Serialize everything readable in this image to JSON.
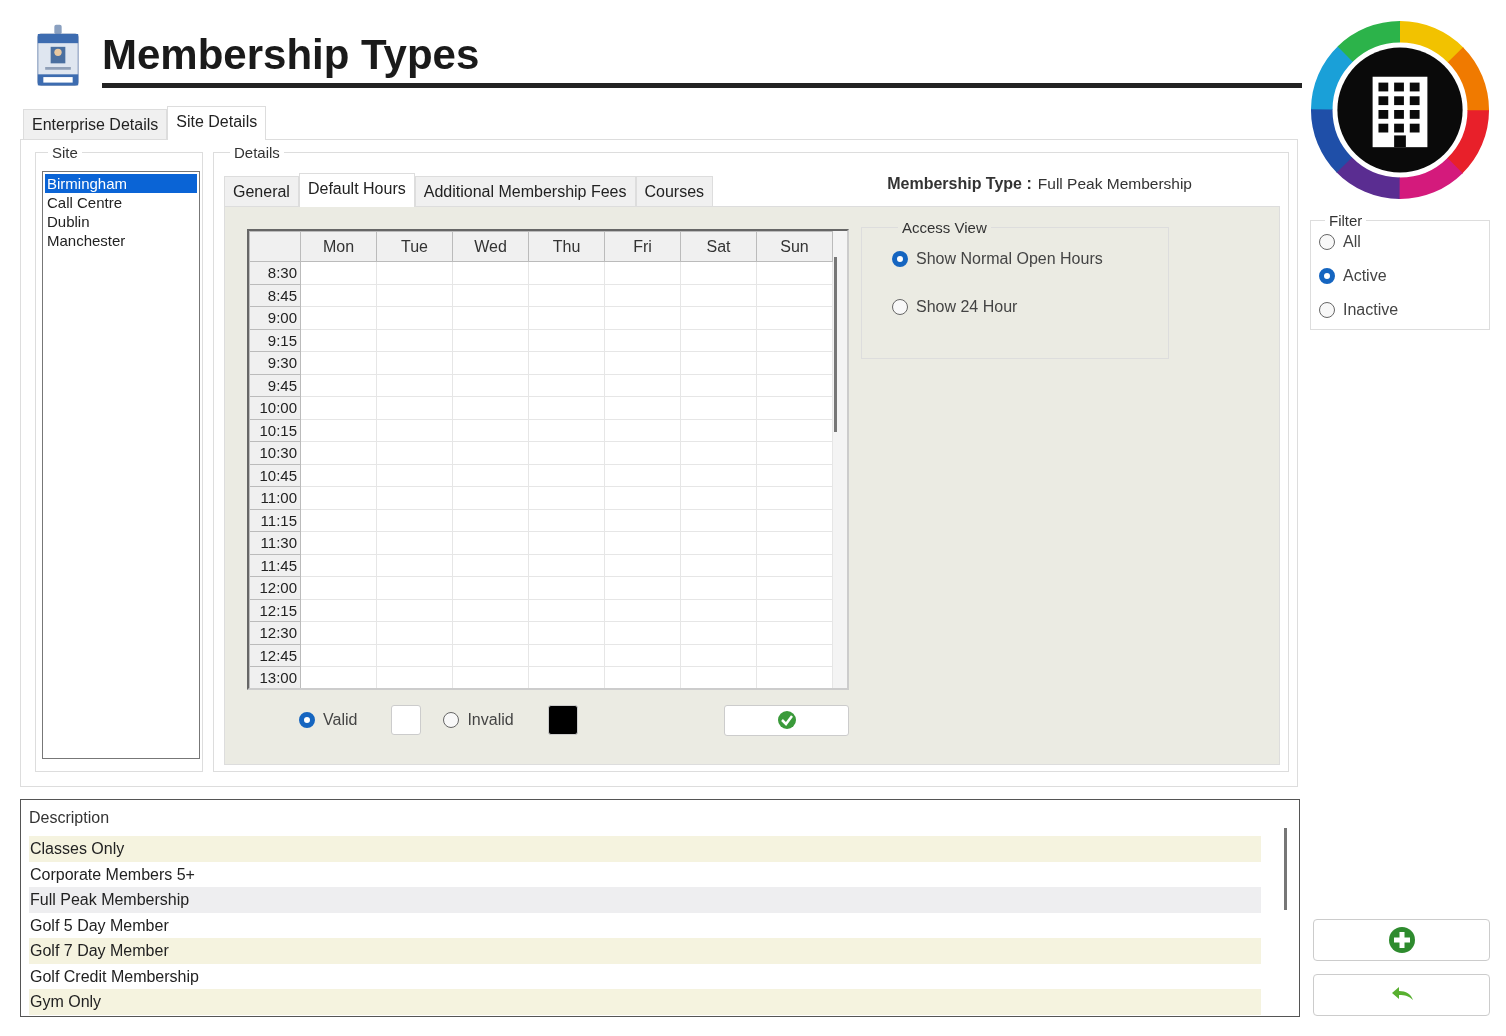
{
  "header": {
    "title": "Membership Types"
  },
  "tabs": [
    {
      "label": "Enterprise Details",
      "selected": false
    },
    {
      "label": "Site Details",
      "selected": true
    }
  ],
  "site": {
    "legend": "Site",
    "items": [
      {
        "label": "Birmingham",
        "selected": true
      },
      {
        "label": "Call Centre",
        "selected": false
      },
      {
        "label": "Dublin",
        "selected": false
      },
      {
        "label": "Manchester",
        "selected": false
      }
    ]
  },
  "details": {
    "legend": "Details",
    "tabs": [
      {
        "label": "General",
        "selected": false
      },
      {
        "label": "Default Hours",
        "selected": true
      },
      {
        "label": "Additional Membership Fees",
        "selected": false
      },
      {
        "label": "Courses",
        "selected": false
      }
    ],
    "membership_type": {
      "label": "Membership Type :",
      "value": "Full Peak Membership"
    },
    "schedule": {
      "columns": [
        "Mon",
        "Tue",
        "Wed",
        "Thu",
        "Fri",
        "Sat",
        "Sun"
      ],
      "times": [
        "8:30",
        "8:45",
        "9:00",
        "9:15",
        "9:30",
        "9:45",
        "10:00",
        "10:15",
        "10:30",
        "10:45",
        "11:00",
        "11:15",
        "11:30",
        "11:45",
        "12:00",
        "12:15",
        "12:30",
        "12:45",
        "13:00"
      ]
    },
    "legend_options": [
      {
        "label": "Valid",
        "selected": true,
        "color": "#ffffff"
      },
      {
        "label": "Invalid",
        "selected": false,
        "color": "#000000"
      }
    ],
    "access_view": {
      "legend": "Access View",
      "options": [
        {
          "label": "Show Normal Open Hours",
          "selected": true
        },
        {
          "label": "Show 24 Hour",
          "selected": false
        }
      ]
    }
  },
  "description_list": {
    "header": "Description",
    "rows": [
      {
        "label": "Classes Only",
        "selected": false
      },
      {
        "label": "Corporate Members 5+",
        "selected": false
      },
      {
        "label": "Full Peak Membership",
        "selected": true
      },
      {
        "label": "Golf 5 Day Member",
        "selected": false
      },
      {
        "label": "Golf 7 Day Member",
        "selected": false
      },
      {
        "label": "Golf Credit Membership",
        "selected": false
      },
      {
        "label": "Gym Only",
        "selected": false
      }
    ]
  },
  "filter": {
    "legend": "Filter",
    "options": [
      {
        "label": "All",
        "selected": false
      },
      {
        "label": "Active",
        "selected": true
      },
      {
        "label": "Inactive",
        "selected": false
      }
    ]
  }
}
